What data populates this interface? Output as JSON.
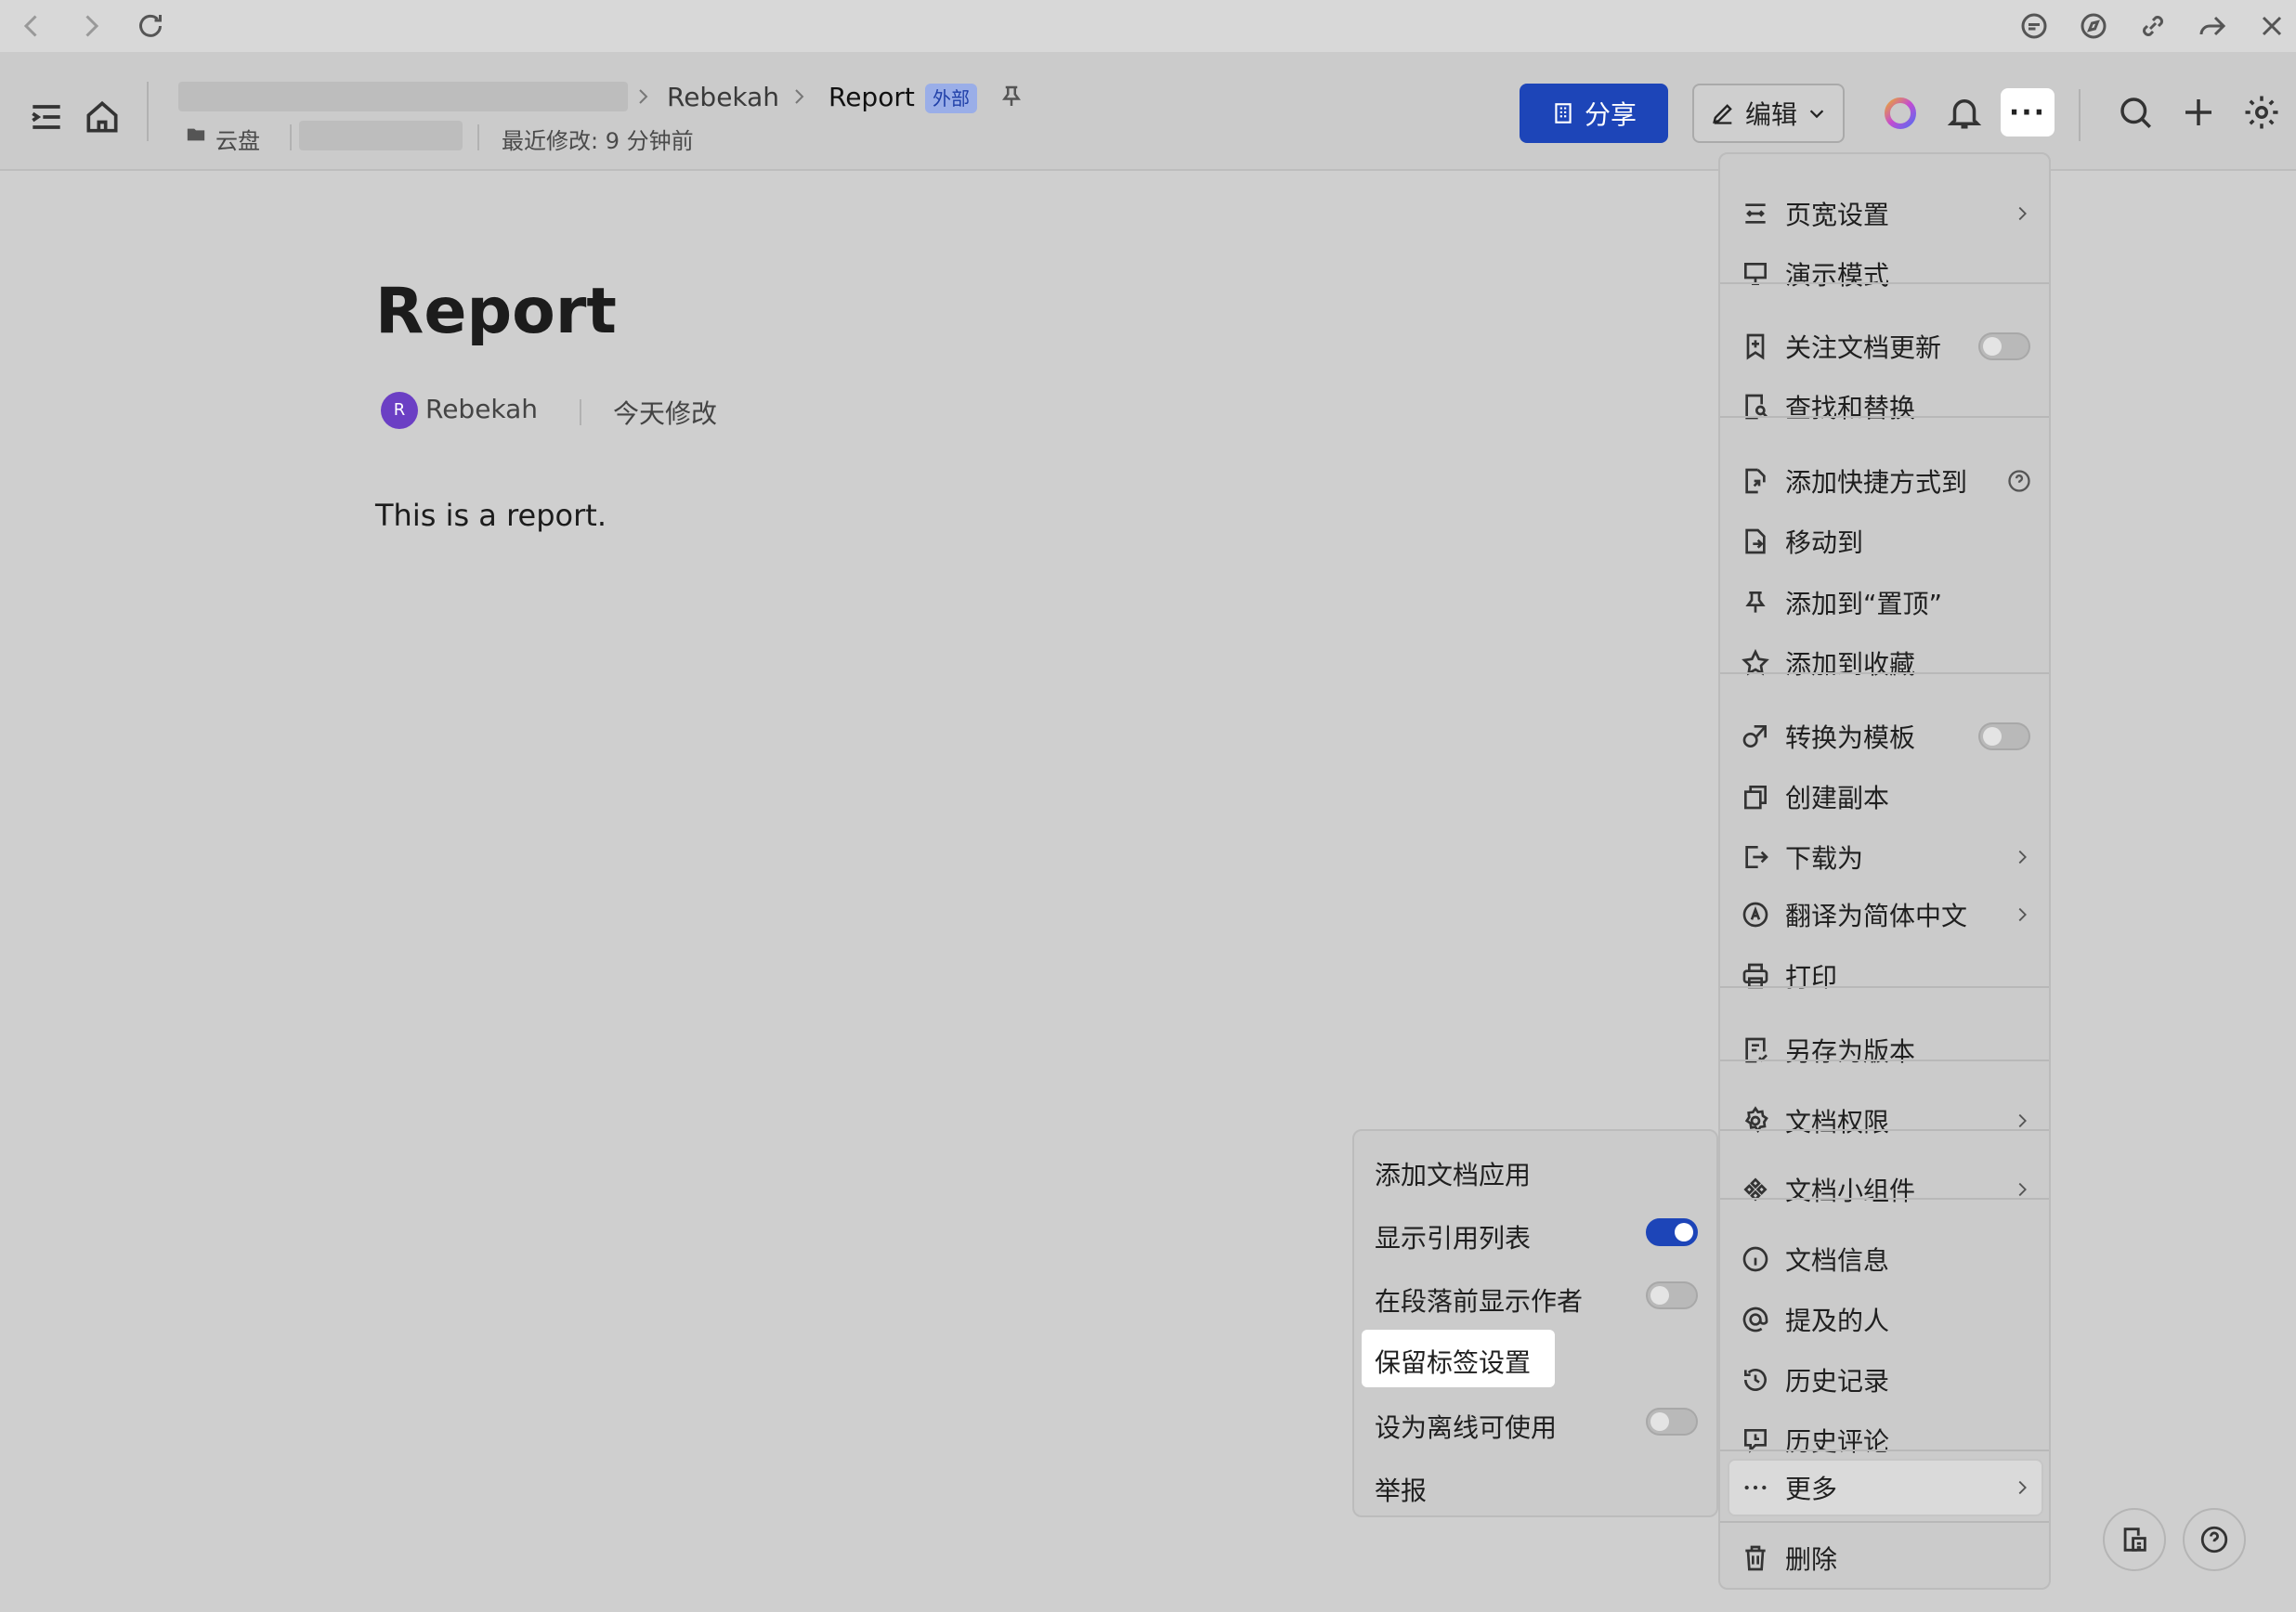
{
  "browser": {
    "icons": [
      "back-icon",
      "forward-icon",
      "reload-icon",
      "chat-icon",
      "compass-icon",
      "link-icon",
      "share-arrow-icon",
      "close-icon"
    ]
  },
  "header": {
    "breadcrumb": [
      {
        "label": "Rebekah"
      },
      {
        "label": "Report"
      }
    ],
    "external_tag": "外部",
    "location": "云盘",
    "last_modified": "最近修改: 9 分钟前",
    "share_label": "分享",
    "edit_label": "编辑",
    "more_label": "···"
  },
  "doc": {
    "title": "Report",
    "author_initial": "R",
    "author": "Rebekah",
    "modified": "今天修改",
    "body": "This is a report."
  },
  "menu": {
    "items": [
      {
        "label": "页宽设置",
        "icon": "page-width-icon",
        "arrow": true
      },
      {
        "label": "演示模式",
        "icon": "present-icon"
      },
      {
        "label": "关注文档更新",
        "icon": "bookmark-plus-icon",
        "toggle": false
      },
      {
        "label": "查找和替换",
        "icon": "find-replace-icon"
      },
      {
        "label": "添加快捷方式到",
        "icon": "shortcut-icon",
        "help": true
      },
      {
        "label": "移动到",
        "icon": "move-icon"
      },
      {
        "label": "添加到“置顶”",
        "icon": "pin-icon"
      },
      {
        "label": "添加到收藏",
        "icon": "star-icon"
      },
      {
        "label": "转换为模板",
        "icon": "template-icon",
        "toggle": false
      },
      {
        "label": "创建副本",
        "icon": "copy-icon"
      },
      {
        "label": "下载为",
        "icon": "download-icon",
        "arrow": true
      },
      {
        "label": "翻译为简体中文",
        "icon": "translate-icon",
        "arrow": true
      },
      {
        "label": "打印",
        "icon": "print-icon"
      },
      {
        "label": "另存为版本",
        "icon": "save-version-icon"
      },
      {
        "label": "文档权限",
        "icon": "gear-icon",
        "arrow": true
      },
      {
        "label": "文档小组件",
        "icon": "widget-icon",
        "arrow": true
      },
      {
        "label": "文档信息",
        "icon": "info-icon"
      },
      {
        "label": "提及的人",
        "icon": "at-icon"
      },
      {
        "label": "历史记录",
        "icon": "history-icon"
      },
      {
        "label": "历史评论",
        "icon": "comment-history-icon"
      },
      {
        "label": "更多",
        "icon": "ellipsis-icon",
        "arrow": true
      },
      {
        "label": "删除",
        "icon": "trash-icon"
      }
    ]
  },
  "submenu": {
    "items": [
      {
        "label": "添加文档应用"
      },
      {
        "label": "显示引用列表",
        "toggle": true
      },
      {
        "label": "在段落前显示作者",
        "toggle": false
      },
      {
        "label": "保留标签设置",
        "highlighted": true
      },
      {
        "label": "设为离线可使用",
        "toggle": false
      },
      {
        "label": "举报"
      }
    ]
  },
  "colors": {
    "accent": "#1d45b8",
    "avatar": "#6b3fc4"
  }
}
